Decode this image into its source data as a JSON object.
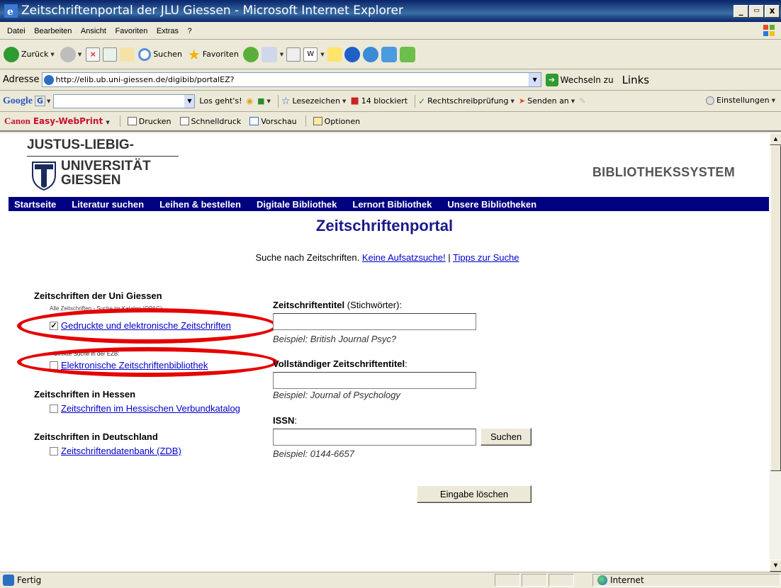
{
  "window": {
    "title": "Zeitschriftenportal der JLU Giessen - Microsoft Internet Explorer",
    "buttons": [
      "_",
      " ",
      "x"
    ]
  },
  "menu": [
    "Datei",
    "Bearbeiten",
    "Ansicht",
    "Favoriten",
    "Extras",
    "?"
  ],
  "toolbar": {
    "back": "Zurück",
    "search": "Suchen",
    "favorites": "Favoriten"
  },
  "address": {
    "label": "Adresse",
    "url": "http://elib.ub.uni-giessen.de/digibib/portalEZ?",
    "go": "Wechseln zu",
    "links": "Links"
  },
  "google_bar": {
    "logo": "Google",
    "search_letter": "G",
    "go": "Los geht's!",
    "bookmarks": "Lesezeichen",
    "blocked": "14 blockiert",
    "spellcheck": "Rechtschreibprüfung",
    "send": "Senden an",
    "settings": "Einstellungen"
  },
  "canon_bar": {
    "brand": "Canon",
    "product": "Easy-WebPrint",
    "print": "Drucken",
    "quickprint": "Schnelldruck",
    "preview": "Vorschau",
    "options": "Optionen"
  },
  "page": {
    "uni_line1": "JUSTUS-LIEBIG-",
    "uni_line2": "UNIVERSITÄT",
    "uni_line3": "GIESSEN",
    "bibliothekssystem": "BIBLIOTHEKSSYSTEM",
    "nav": [
      "Startseite",
      "Literatur suchen",
      "Leihen & bestellen",
      "Digitale Bibliothek",
      "Lernort Bibliothek",
      "Unsere Bibliotheken"
    ],
    "title": "Zeitschriftenportal",
    "intro_text": "Suche nach Zeitschriften.",
    "intro_link1": "Keine Aufsatzsuche!",
    "intro_sep": "|",
    "intro_link2": "Tipps zur Suche",
    "left": {
      "uni_heading": "Zeitschriften der Uni Giessen",
      "uni_note": "Alle Zeitschriften - Suche im Katalog (OPAC):",
      "printed_label": "Gedruckte und elektronische Zeitschriften",
      "printed_checked": true,
      "ezb_note": "Direkte Suche in der EZB:",
      "ezb_label": "Elektronische Zeitschriftenbibliothek",
      "ezb_checked": false,
      "hessen_heading": "Zeitschriften in Hessen",
      "hessen_label": "Zeitschriften im Hessischen Verbundkatalog",
      "hessen_checked": false,
      "de_heading": "Zeitschriften in Deutschland",
      "de_label": "Zeitschriftendatenbank (ZDB)",
      "de_checked": false
    },
    "right": {
      "title_label_bold": "Zeitschriftentitel",
      "title_label_rest": " (Stichwörter):",
      "title_value": "",
      "title_example": "Beispiel: British Journal Psyc?",
      "fulltitle_label": "Vollständiger Zeitschriftentitel",
      "fulltitle_colon": ":",
      "fulltitle_value": "",
      "fulltitle_example": "Beispiel: Journal of Psychology",
      "issn_label": "ISSN",
      "issn_colon": ":",
      "issn_value": "",
      "issn_example": "Beispiel: 0144-6657",
      "search_button": "Suchen",
      "clear_button": "Eingabe löschen"
    },
    "highlight_color": "#e60000"
  },
  "status": {
    "text": "Fertig",
    "zone": "Internet"
  }
}
